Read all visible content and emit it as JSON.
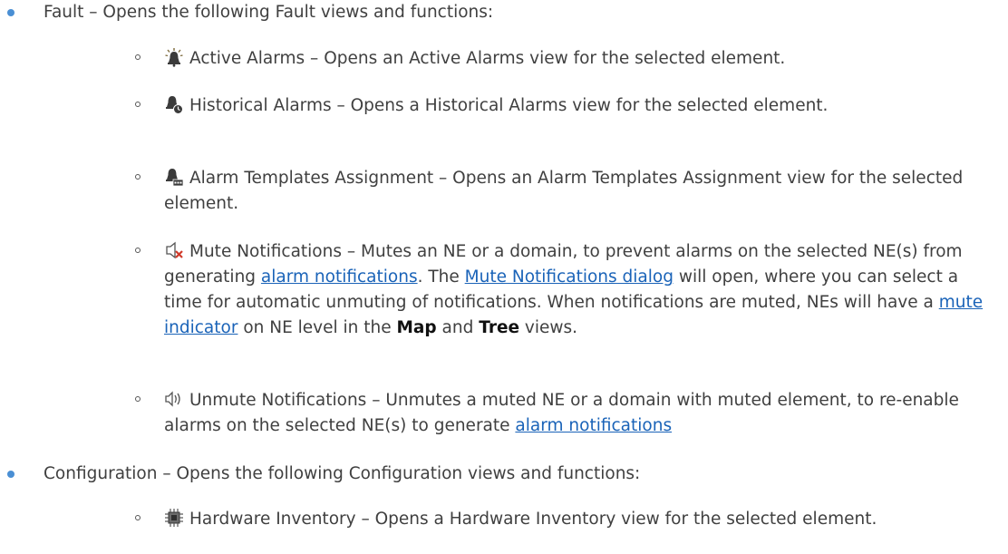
{
  "fault": {
    "label": "Fault – Opens the following Fault views and functions:",
    "items": {
      "active": {
        "icon": "bell-alert-icon",
        "text": "Active Alarms – Opens an Active Alarms view for the selected element."
      },
      "historical": {
        "icon": "bell-history-icon",
        "text": "Historical Alarms – Opens a Historical Alarms view for the selected element."
      },
      "templates": {
        "icon": "bell-template-icon",
        "text": "Alarm Templates Assignment – Opens an Alarm Templates Assignment view for the selected element."
      },
      "mute": {
        "icon": "speaker-mute-icon",
        "t1": "Mute Notifications – Mutes an NE or a domain, to prevent alarms on the selected NE(s) from generating ",
        "link1": "alarm notifications",
        "t2": ". The ",
        "link2": "Mute Notifications dialog",
        "t3": " will open, where you can select a time for automatic unmuting of notifications. When notifications are muted, NEs will have a ",
        "link3": "mute indicator",
        "t4": " on NE level in the ",
        "map": "Map",
        "t5": " and ",
        "tree": "Tree",
        "t6": " views."
      },
      "unmute": {
        "icon": "speaker-unmute-icon",
        "t1": "Unmute Notifications – Unmutes a muted NE or a domain with muted element, to re-enable alarms on the selected NE(s) to generate ",
        "link1": "alarm notifications"
      }
    }
  },
  "configuration": {
    "label": "Configuration – Opens the following Configuration views and functions:",
    "items": {
      "hardware": {
        "icon": "chip-icon",
        "text": "Hardware Inventory – Opens a Hardware Inventory view for the selected element."
      }
    }
  },
  "colors": {
    "bullet": "#4a8fd4",
    "link": "#1a63b8",
    "text": "#404040"
  }
}
